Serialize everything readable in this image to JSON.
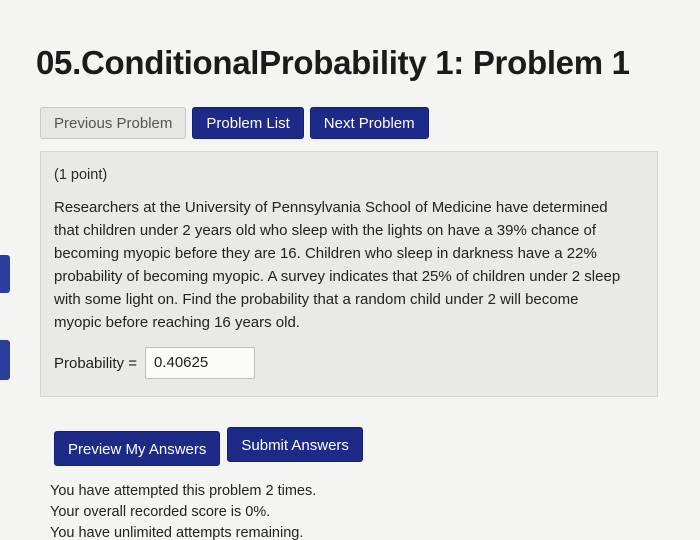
{
  "title": "05.ConditionalProbability 1: Problem 1",
  "nav": {
    "previous": "Previous Problem",
    "list": "Problem List",
    "next": "Next Problem"
  },
  "problem": {
    "points": "(1 point)",
    "lines": [
      "Researchers at the University of Pennsylvania School of Medicine have determined",
      "that children under 2 years old who sleep with the lights on have a 39% chance of",
      "becoming myopic before they are 16. Children who sleep in darkness have a 22%",
      "probability of becoming myopic. A survey indicates that 25% of children under 2 sleep",
      "with some light on. Find the probability that a random child under 2 will become",
      "myopic before reaching 16 years old."
    ],
    "answer_label": "Probability =",
    "answer_value": "0.40625"
  },
  "actions": {
    "preview": "Preview My Answers",
    "submit": "Submit Answers"
  },
  "status": {
    "attempts": "You have attempted this problem 2 times.",
    "score": "Your overall recorded score is 0%.",
    "remaining": "You have unlimited attempts remaining."
  },
  "colors": {
    "accent": "#1d2a88",
    "background": "#f4f4f2",
    "panel": "#e9e9e6"
  }
}
